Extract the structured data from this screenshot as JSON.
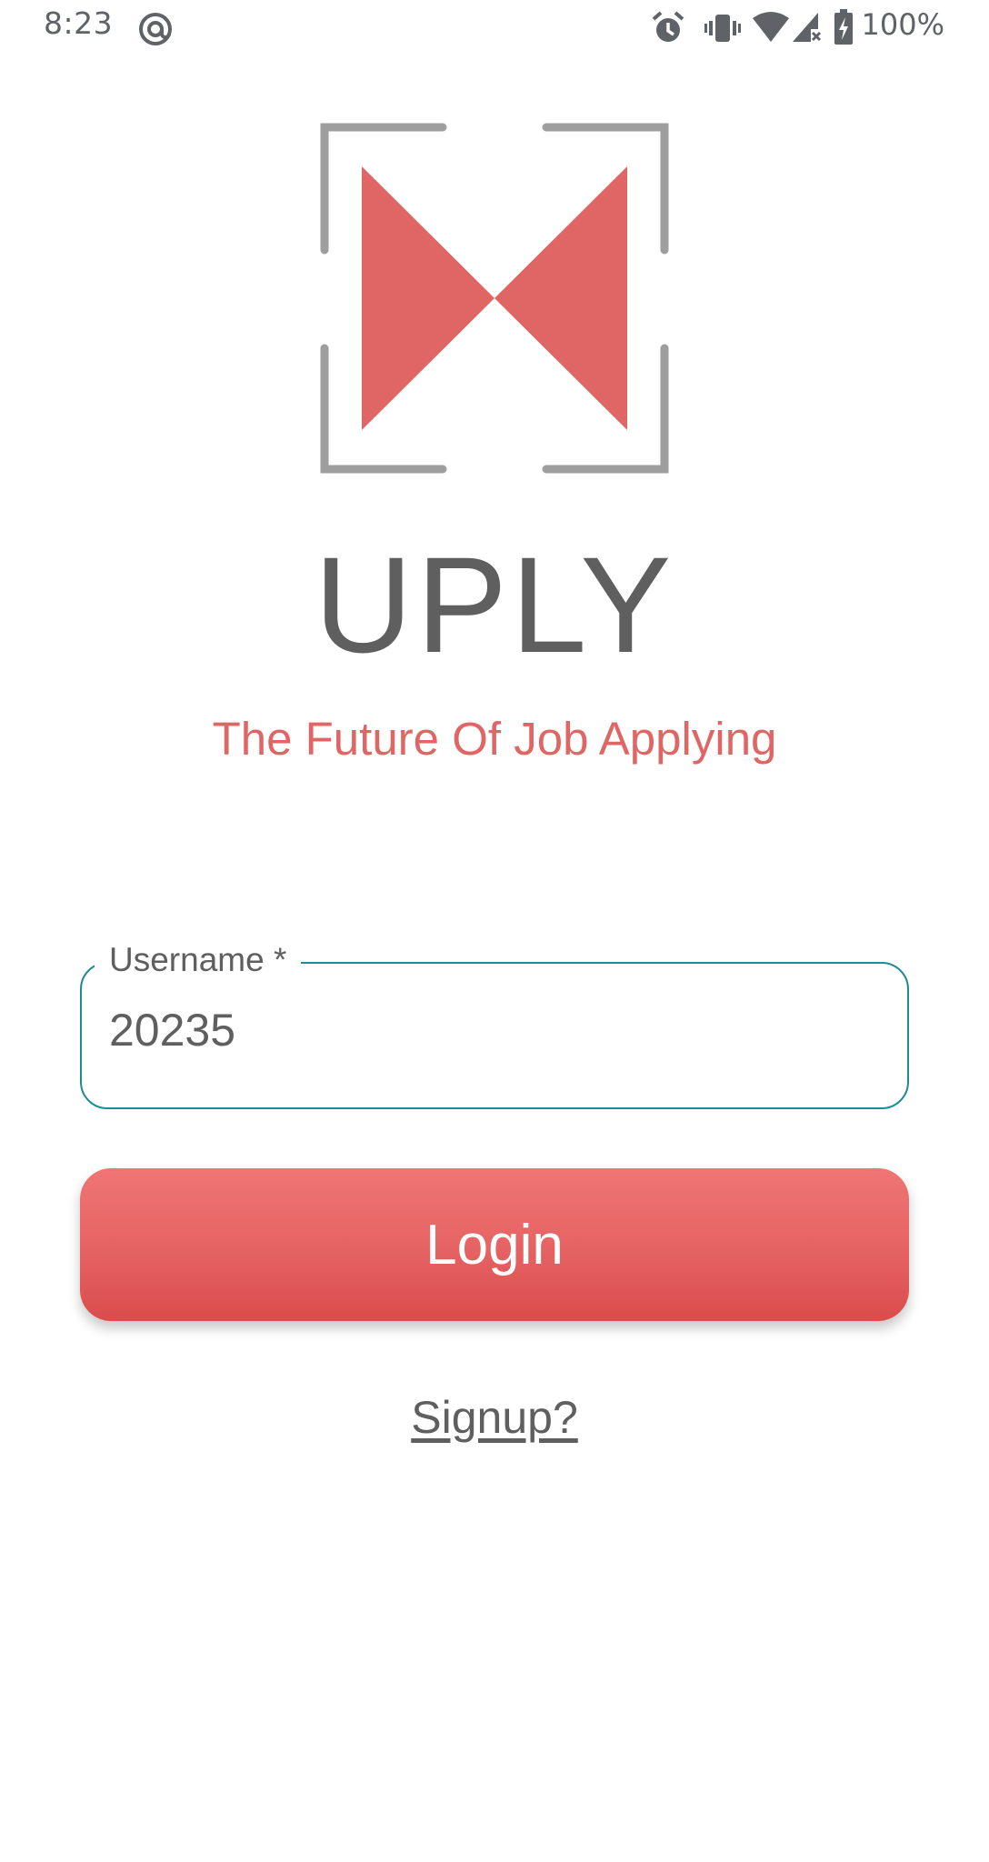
{
  "status_bar": {
    "time": "8:23",
    "battery_text": "100%",
    "icons": [
      "at-sign-icon",
      "alarm-icon",
      "vibrate-icon",
      "wifi-icon",
      "cell-signal-icon",
      "battery-icon"
    ]
  },
  "brand": {
    "logo": "bowtie-logo",
    "name": "UPLY",
    "tagline": "The Future Of Job Applying",
    "accent_color": "#e06666",
    "frame_color": "#9e9e9e"
  },
  "username_field": {
    "label": "Username *",
    "value": "20235",
    "border_color": "#1f8a94"
  },
  "login_button": {
    "label": "Login"
  },
  "signup_link": {
    "label": "Signup?"
  }
}
